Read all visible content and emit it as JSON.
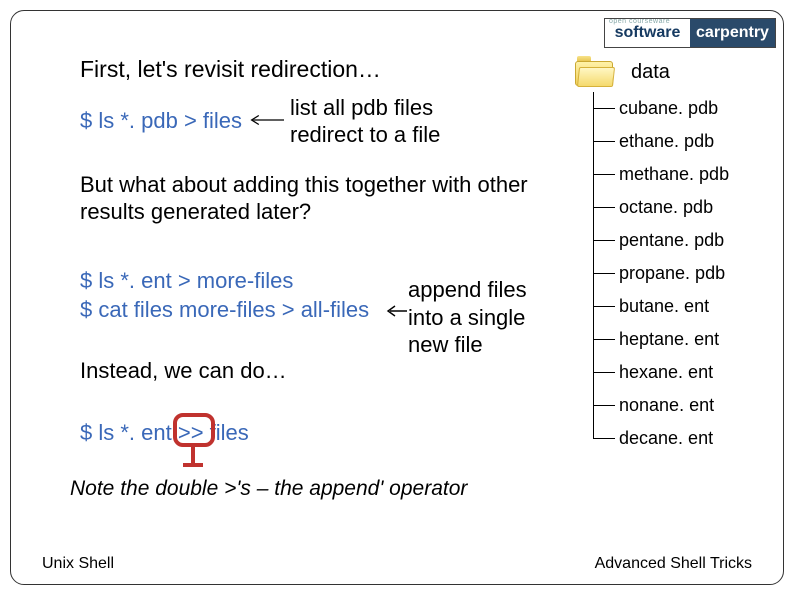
{
  "logo": {
    "left": "software",
    "left_sub": "open courseware",
    "right": "carpentry"
  },
  "heading": "First, let's revisit redirection…",
  "cmd1": "$ ls *. pdb > files",
  "note1a": "list all pdb files",
  "note1b": "redirect to a file",
  "para2": "But what about adding this together with other results generated later?",
  "cmd2": "$ ls *. ent > more-files",
  "cmd3": "$ cat files more-files > all-files",
  "note2": "append files\ninto a single\nnew file",
  "para3": "Instead, we can do…",
  "cmd4_pre": "$ ls *. ent ",
  "cmd4_op": ">>",
  "cmd4_post": " files",
  "note3": "Note the double >'s – the append' operator",
  "footer_left": "Unix Shell",
  "footer_right": "Advanced Shell Tricks",
  "tree": {
    "folder_label": "data",
    "files": [
      "cubane. pdb",
      "ethane. pdb",
      "methane. pdb",
      "octane. pdb",
      "pentane. pdb",
      "propane. pdb",
      "butane. ent",
      "heptane. ent",
      "hexane. ent",
      "nonane. ent",
      "decane. ent"
    ]
  }
}
